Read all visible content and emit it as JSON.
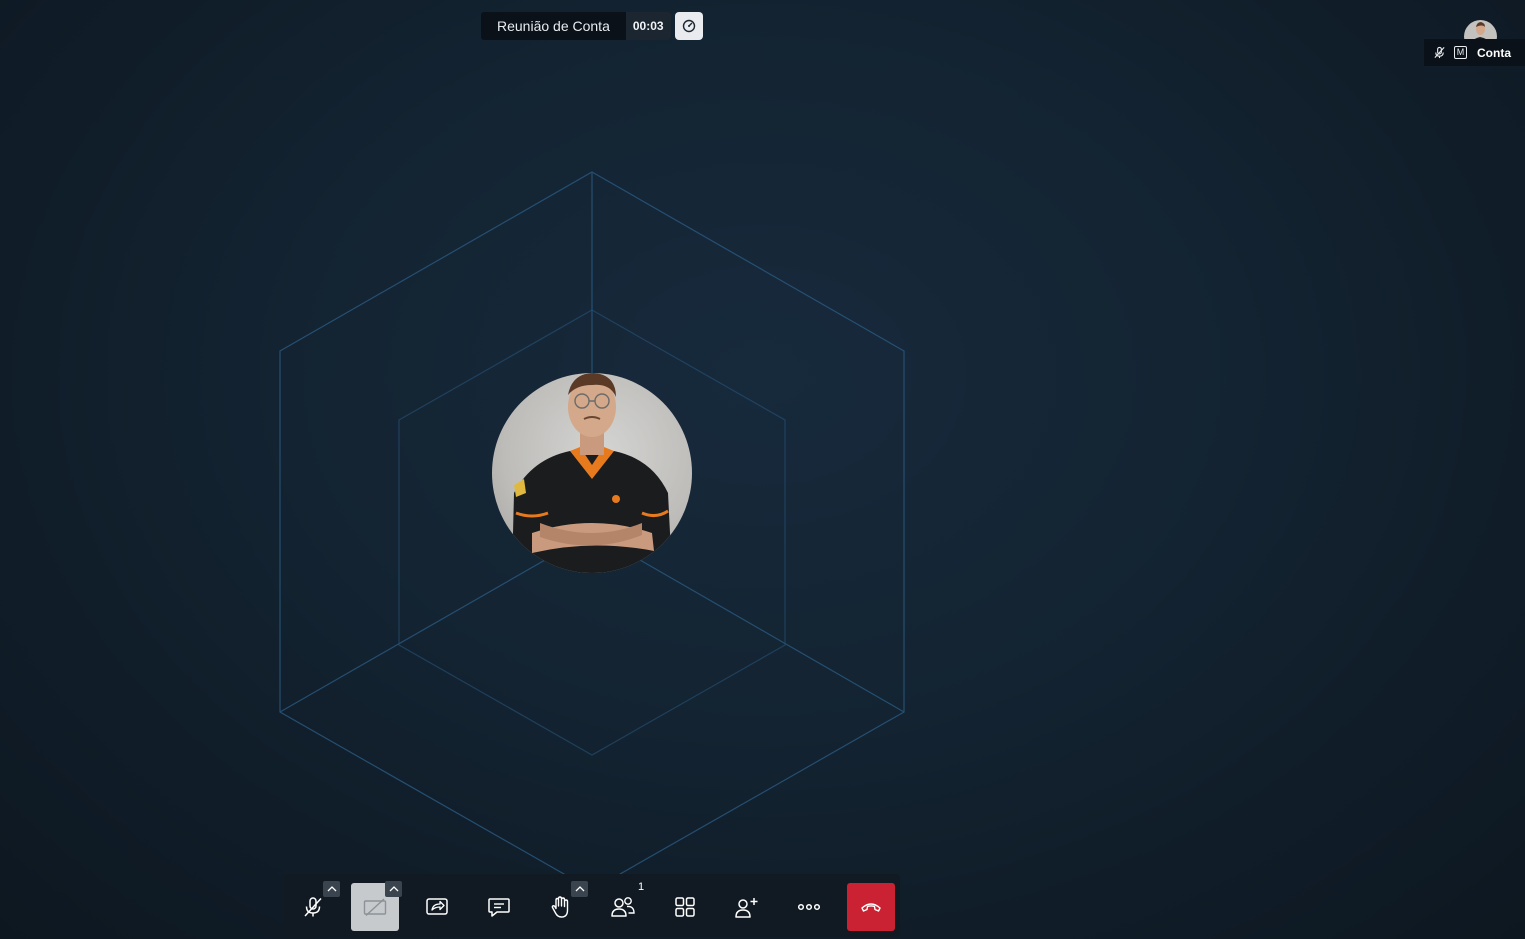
{
  "meeting": {
    "title": "Reunião de Conta",
    "timer": "00:03"
  },
  "self_view": {
    "name": "Conta",
    "moderator_badge": "M"
  },
  "toolbar": {
    "participants_count": "1",
    "buttons": [
      {
        "name": "microphone",
        "state": "muted"
      },
      {
        "name": "camera",
        "state": "off"
      },
      {
        "name": "share-screen"
      },
      {
        "name": "chat"
      },
      {
        "name": "raise-hand"
      },
      {
        "name": "participants"
      },
      {
        "name": "tile-view"
      },
      {
        "name": "invite"
      },
      {
        "name": "more-actions"
      },
      {
        "name": "hangup"
      }
    ]
  },
  "colors": {
    "background": "#132331",
    "hexagon_stroke": "#2a5a82",
    "hangup": "#cb2233",
    "active_button": "#c7cacd"
  }
}
